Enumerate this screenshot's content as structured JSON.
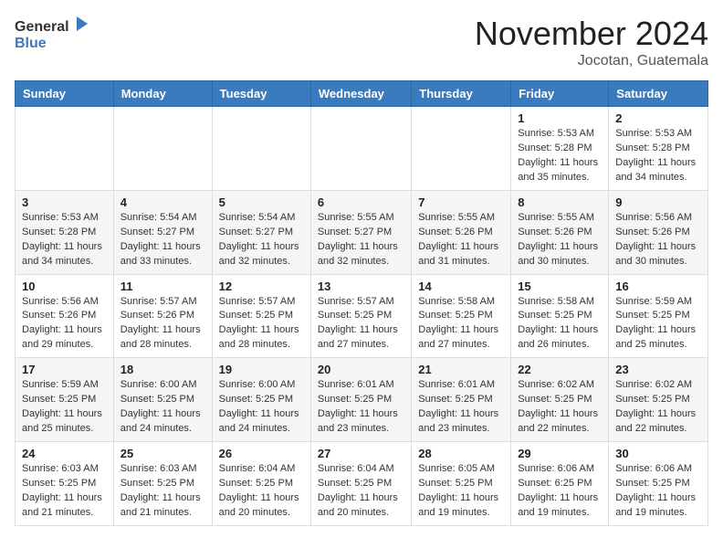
{
  "header": {
    "logo_general": "General",
    "logo_blue": "Blue",
    "month_title": "November 2024",
    "location": "Jocotan, Guatemala"
  },
  "weekdays": [
    "Sunday",
    "Monday",
    "Tuesday",
    "Wednesday",
    "Thursday",
    "Friday",
    "Saturday"
  ],
  "weeks": [
    [
      {
        "day": "",
        "info": ""
      },
      {
        "day": "",
        "info": ""
      },
      {
        "day": "",
        "info": ""
      },
      {
        "day": "",
        "info": ""
      },
      {
        "day": "",
        "info": ""
      },
      {
        "day": "1",
        "info": "Sunrise: 5:53 AM\nSunset: 5:28 PM\nDaylight: 11 hours and 35 minutes."
      },
      {
        "day": "2",
        "info": "Sunrise: 5:53 AM\nSunset: 5:28 PM\nDaylight: 11 hours and 34 minutes."
      }
    ],
    [
      {
        "day": "3",
        "info": "Sunrise: 5:53 AM\nSunset: 5:28 PM\nDaylight: 11 hours and 34 minutes."
      },
      {
        "day": "4",
        "info": "Sunrise: 5:54 AM\nSunset: 5:27 PM\nDaylight: 11 hours and 33 minutes."
      },
      {
        "day": "5",
        "info": "Sunrise: 5:54 AM\nSunset: 5:27 PM\nDaylight: 11 hours and 32 minutes."
      },
      {
        "day": "6",
        "info": "Sunrise: 5:55 AM\nSunset: 5:27 PM\nDaylight: 11 hours and 32 minutes."
      },
      {
        "day": "7",
        "info": "Sunrise: 5:55 AM\nSunset: 5:26 PM\nDaylight: 11 hours and 31 minutes."
      },
      {
        "day": "8",
        "info": "Sunrise: 5:55 AM\nSunset: 5:26 PM\nDaylight: 11 hours and 30 minutes."
      },
      {
        "day": "9",
        "info": "Sunrise: 5:56 AM\nSunset: 5:26 PM\nDaylight: 11 hours and 30 minutes."
      }
    ],
    [
      {
        "day": "10",
        "info": "Sunrise: 5:56 AM\nSunset: 5:26 PM\nDaylight: 11 hours and 29 minutes."
      },
      {
        "day": "11",
        "info": "Sunrise: 5:57 AM\nSunset: 5:26 PM\nDaylight: 11 hours and 28 minutes."
      },
      {
        "day": "12",
        "info": "Sunrise: 5:57 AM\nSunset: 5:25 PM\nDaylight: 11 hours and 28 minutes."
      },
      {
        "day": "13",
        "info": "Sunrise: 5:57 AM\nSunset: 5:25 PM\nDaylight: 11 hours and 27 minutes."
      },
      {
        "day": "14",
        "info": "Sunrise: 5:58 AM\nSunset: 5:25 PM\nDaylight: 11 hours and 27 minutes."
      },
      {
        "day": "15",
        "info": "Sunrise: 5:58 AM\nSunset: 5:25 PM\nDaylight: 11 hours and 26 minutes."
      },
      {
        "day": "16",
        "info": "Sunrise: 5:59 AM\nSunset: 5:25 PM\nDaylight: 11 hours and 25 minutes."
      }
    ],
    [
      {
        "day": "17",
        "info": "Sunrise: 5:59 AM\nSunset: 5:25 PM\nDaylight: 11 hours and 25 minutes."
      },
      {
        "day": "18",
        "info": "Sunrise: 6:00 AM\nSunset: 5:25 PM\nDaylight: 11 hours and 24 minutes."
      },
      {
        "day": "19",
        "info": "Sunrise: 6:00 AM\nSunset: 5:25 PM\nDaylight: 11 hours and 24 minutes."
      },
      {
        "day": "20",
        "info": "Sunrise: 6:01 AM\nSunset: 5:25 PM\nDaylight: 11 hours and 23 minutes."
      },
      {
        "day": "21",
        "info": "Sunrise: 6:01 AM\nSunset: 5:25 PM\nDaylight: 11 hours and 23 minutes."
      },
      {
        "day": "22",
        "info": "Sunrise: 6:02 AM\nSunset: 5:25 PM\nDaylight: 11 hours and 22 minutes."
      },
      {
        "day": "23",
        "info": "Sunrise: 6:02 AM\nSunset: 5:25 PM\nDaylight: 11 hours and 22 minutes."
      }
    ],
    [
      {
        "day": "24",
        "info": "Sunrise: 6:03 AM\nSunset: 5:25 PM\nDaylight: 11 hours and 21 minutes."
      },
      {
        "day": "25",
        "info": "Sunrise: 6:03 AM\nSunset: 5:25 PM\nDaylight: 11 hours and 21 minutes."
      },
      {
        "day": "26",
        "info": "Sunrise: 6:04 AM\nSunset: 5:25 PM\nDaylight: 11 hours and 20 minutes."
      },
      {
        "day": "27",
        "info": "Sunrise: 6:04 AM\nSunset: 5:25 PM\nDaylight: 11 hours and 20 minutes."
      },
      {
        "day": "28",
        "info": "Sunrise: 6:05 AM\nSunset: 5:25 PM\nDaylight: 11 hours and 19 minutes."
      },
      {
        "day": "29",
        "info": "Sunrise: 6:06 AM\nSunset: 6:25 PM\nDaylight: 11 hours and 19 minutes."
      },
      {
        "day": "30",
        "info": "Sunrise: 6:06 AM\nSunset: 5:25 PM\nDaylight: 11 hours and 19 minutes."
      }
    ]
  ]
}
